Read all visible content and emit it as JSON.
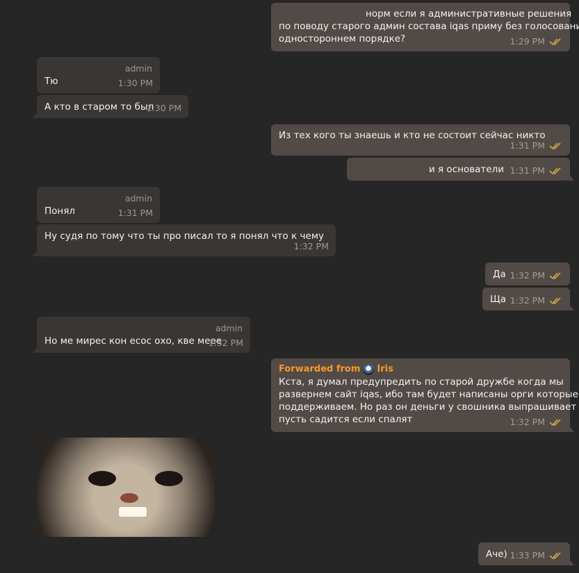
{
  "chat": {
    "messages": [
      {
        "id": "m1",
        "direction": "out",
        "text_lines": [
          "норм если я административные решения",
          "по поводу старого админ состава iqas приму без голосования в",
          "одностороннем порядке?"
        ],
        "time": "1:29 PM"
      },
      {
        "id": "m2",
        "direction": "in",
        "role": "admin",
        "text": "Тю",
        "time": "1:30 PM"
      },
      {
        "id": "m3",
        "direction": "in",
        "text": "А кто в старом то был",
        "time": "1:30 PM"
      },
      {
        "id": "m4",
        "direction": "out",
        "text": "Из тех кого ты знаешь и кто не состоит сейчас никто",
        "time": "1:31 PM"
      },
      {
        "id": "m5",
        "direction": "out",
        "text": "и я основатели",
        "time": "1:31 PM"
      },
      {
        "id": "m6",
        "direction": "in",
        "role": "admin",
        "text": "Понял",
        "time": "1:31 PM"
      },
      {
        "id": "m7",
        "direction": "in",
        "text": "Ну судя по тому что ты про             писал то я понял что к чему",
        "time": "1:32 PM"
      },
      {
        "id": "m8",
        "direction": "out",
        "text": "Да",
        "time": "1:32 PM"
      },
      {
        "id": "m9",
        "direction": "out",
        "text": "Ща",
        "time": "1:32 PM"
      },
      {
        "id": "m10",
        "direction": "in",
        "role": "admin",
        "text": "Но ме мирес кон есос охо, кве мееe",
        "time": "1:32 PM"
      },
      {
        "id": "m11",
        "direction": "out",
        "forwarded_label": "Forwarded from",
        "forwarded_name": "Iris",
        "text_lines": [
          "Кста, я думал                   предупредить по старой дружбе когда мы",
          "развернем сайт iqas, ибо там будет написаны орги которые мы",
          "поддерживаем. Но раз он деньги у свошника выпрашивает то",
          "пусть садится если спалят"
        ],
        "time": "1:32 PM"
      },
      {
        "id": "m12",
        "direction": "in",
        "type": "sticker",
        "description": "smiling cat sticker"
      },
      {
        "id": "m13",
        "direction": "out",
        "text": "Аче)",
        "time": "1:33 PM"
      }
    ]
  },
  "colors": {
    "background": "#262626",
    "incoming_bubble": "#3a3633",
    "outgoing_bubble": "#524a46",
    "meta": "#a69c95",
    "forward_accent": "#f39a2b",
    "read_check": "#c9a74a"
  },
  "icons": {
    "read_check": "double-check-icon",
    "forward_avatar": "avatar-icon"
  }
}
